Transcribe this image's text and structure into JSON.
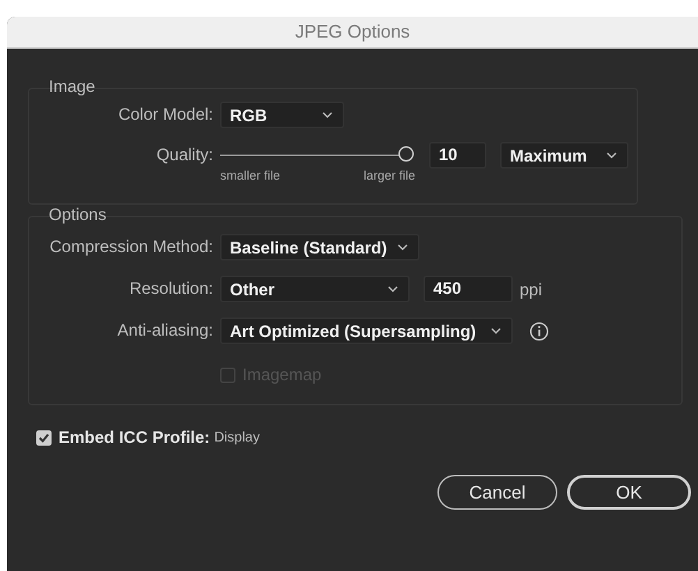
{
  "window": {
    "title": "JPEG Options"
  },
  "image_group": {
    "legend": "Image",
    "color_model": {
      "label": "Color Model:",
      "value": "RGB"
    },
    "quality": {
      "label": "Quality:",
      "level": 1,
      "value": "10",
      "preset": "Maximum",
      "min_label": "smaller file",
      "max_label": "larger file"
    }
  },
  "options_group": {
    "legend": "Options",
    "compression": {
      "label": "Compression Method:",
      "value": "Baseline (Standard)"
    },
    "resolution": {
      "label": "Resolution:",
      "value": "Other",
      "field": "450",
      "unit": "ppi"
    },
    "anti_aliasing": {
      "label": "Anti-aliasing:",
      "value": "Art Optimized (Supersampling)"
    },
    "imagemap": {
      "label": "Imagemap",
      "checked": false,
      "disabled": true
    }
  },
  "embed_icc": {
    "label": "Embed ICC Profile:",
    "detail": "Display",
    "checked": true
  },
  "buttons": [
    {
      "label": "Cancel",
      "default": false
    },
    {
      "label": "OK",
      "default": true
    }
  ]
}
